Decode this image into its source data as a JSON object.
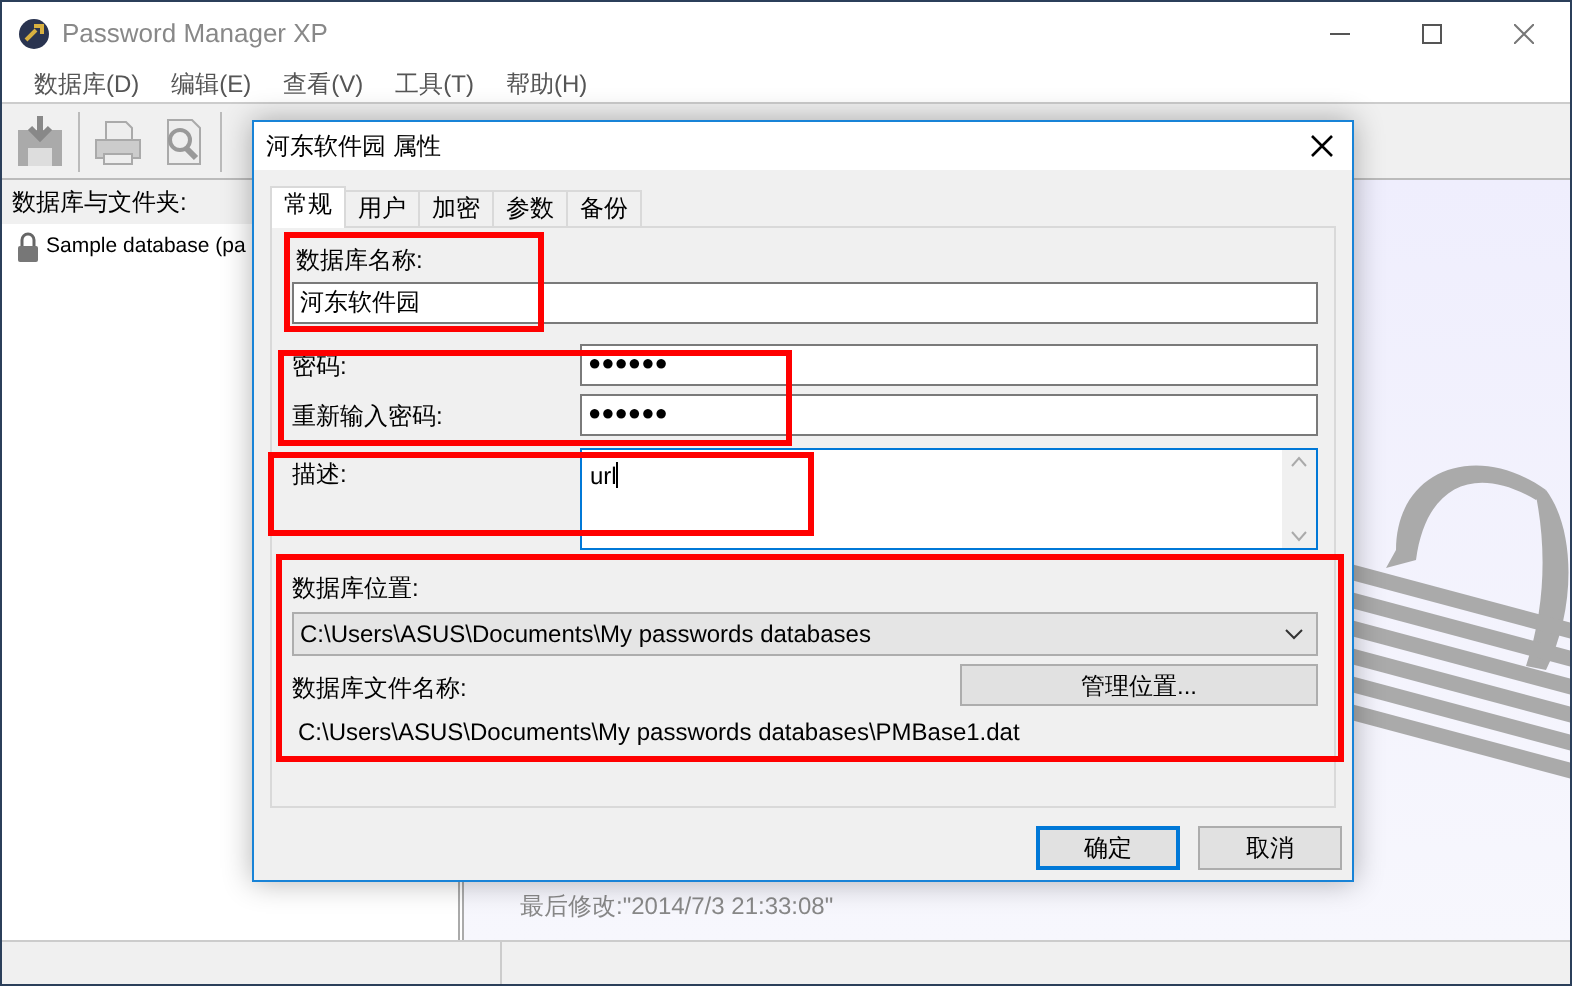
{
  "window": {
    "title": "Password Manager XP"
  },
  "menu": [
    {
      "label": "数据库(D)"
    },
    {
      "label": "编辑(E)"
    },
    {
      "label": "查看(V)"
    },
    {
      "label": "工具(T)"
    },
    {
      "label": "帮助(H)"
    }
  ],
  "sidebar": {
    "heading": "数据库与文件夹:",
    "items": [
      {
        "label": "Sample database (pa",
        "selected": false
      }
    ]
  },
  "details": {
    "last_modified": "最后修改:\"2014/7/3 21:33:08\""
  },
  "dialog": {
    "title": "河东软件园 属性",
    "tabs": [
      {
        "label": "常规",
        "selected": true
      },
      {
        "label": "用户",
        "selected": false
      },
      {
        "label": "加密",
        "selected": false
      },
      {
        "label": "参数",
        "selected": false
      },
      {
        "label": "备份",
        "selected": false
      }
    ],
    "sections": [
      {
        "highlighted": true,
        "fields": [
          {
            "kind": "text",
            "label": "数据库名称:",
            "value": "河东软件园"
          }
        ]
      },
      {
        "highlighted": true,
        "fields": [
          {
            "kind": "password",
            "label": "密码:",
            "value": "●●●●●●"
          },
          {
            "kind": "password",
            "label": "重新输入密码:",
            "value": "●●●●●●"
          }
        ]
      },
      {
        "highlighted": true,
        "fields": [
          {
            "kind": "memo",
            "label": "描述:",
            "value": "url",
            "focused": true
          }
        ]
      },
      {
        "highlighted": true,
        "fields": [
          {
            "kind": "combo",
            "label": "数据库位置:",
            "value": "C:\\Users\\ASUS\\Documents\\My passwords databases"
          },
          {
            "kind": "path",
            "label": "数据库文件名称:",
            "value": "C:\\Users\\ASUS\\Documents\\My passwords databases\\PMBase1.dat",
            "button": "管理位置..."
          }
        ]
      }
    ],
    "buttons": [
      {
        "label": "确定",
        "default": true
      },
      {
        "label": "取消",
        "default": false
      }
    ]
  }
}
